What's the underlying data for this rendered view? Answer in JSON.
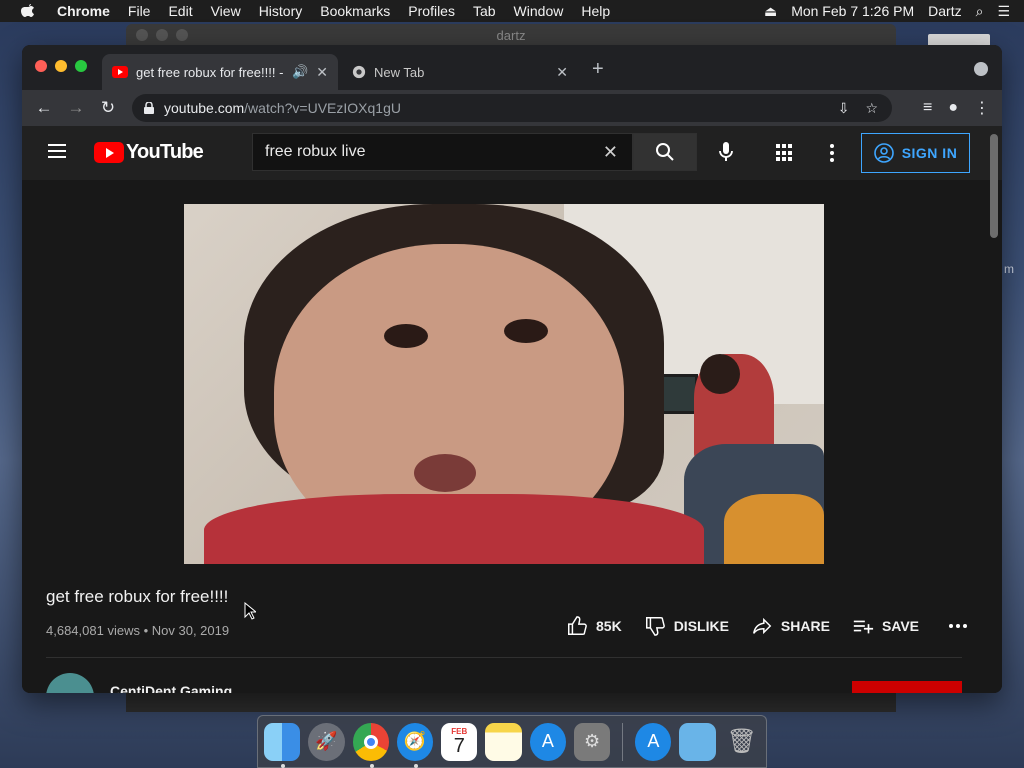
{
  "menubar": {
    "app_name": "Chrome",
    "items": [
      "File",
      "Edit",
      "View",
      "History",
      "Bookmarks",
      "Profiles",
      "Tab",
      "Window",
      "Help"
    ],
    "datetime": "Mon Feb 7  1:26 PM",
    "user": "Dartz"
  },
  "background_window": {
    "title": "dartz"
  },
  "browser": {
    "tabs": [
      {
        "title": "get free robux for free!!!! -",
        "active": true
      },
      {
        "title": "New Tab",
        "active": false
      }
    ],
    "url_host": "youtube.com",
    "url_path": "/watch?v=UVEzIOXq1gU"
  },
  "youtube": {
    "logo_text": "YouTube",
    "search_value": "free robux live",
    "sign_in_label": "SIGN IN",
    "video": {
      "title": "get free robux for free!!!!",
      "views": "4,684,081 views",
      "date": "Nov 30, 2019",
      "separator": "•",
      "likes": "85K",
      "dislike_label": "DISLIKE",
      "share_label": "SHARE",
      "save_label": "SAVE"
    },
    "channel_name": "CentiDent Gaming"
  },
  "dock": {
    "apps": [
      "Finder",
      "Launchpad",
      "Chrome",
      "Safari",
      "Calendar",
      "Notes",
      "App Store",
      "System Preferences",
      "Downloads",
      "Folder",
      "Trash"
    ],
    "calendar_month": "FEB",
    "calendar_day": "7"
  },
  "colors": {
    "yt_red": "#ff0000",
    "sign_in_blue": "#3ea6ff",
    "page_bg": "#181818"
  }
}
